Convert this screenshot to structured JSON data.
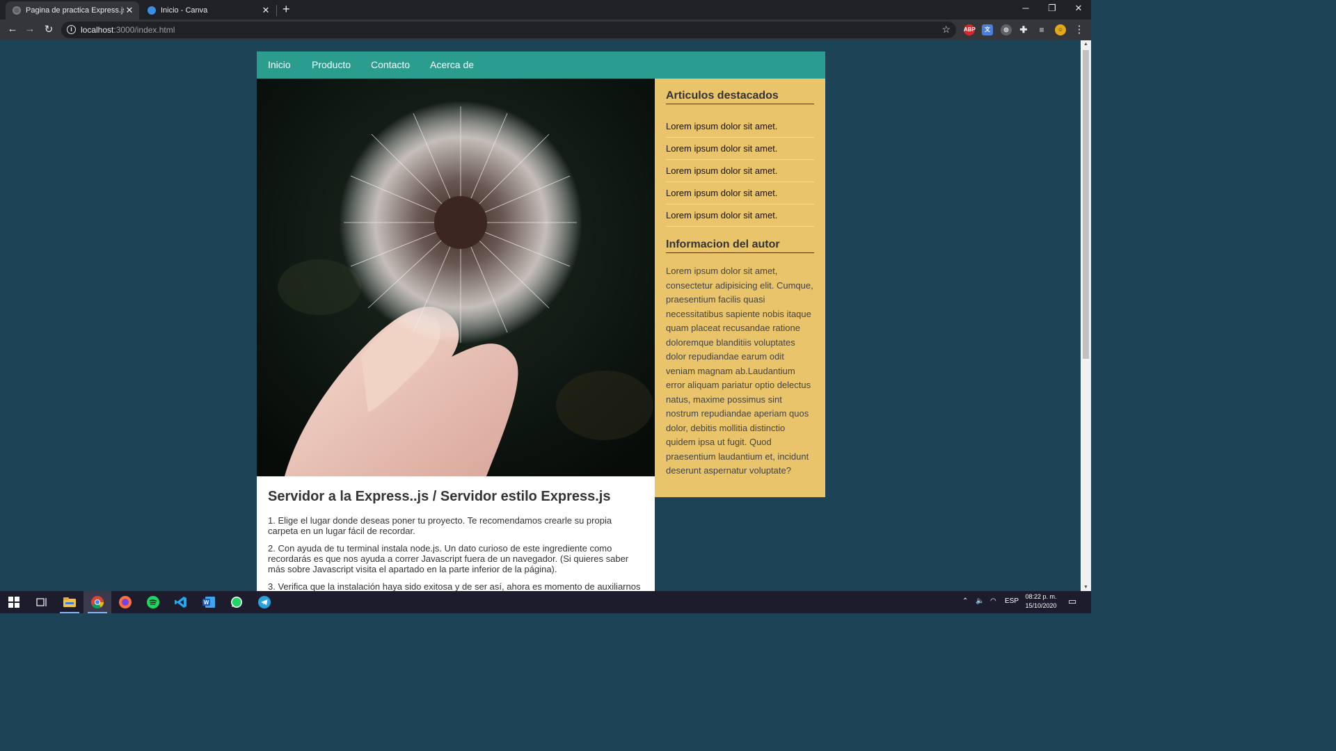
{
  "browser": {
    "tabs": [
      {
        "title": "Pagina de practica Express.js",
        "active": true
      },
      {
        "title": "Inicio - Canva",
        "active": false
      }
    ],
    "new_tab_label": "+",
    "url_host": "localhost",
    "url_path": ":3000/index.html",
    "extensions": [
      "adblock-plus-icon",
      "google-translate-icon",
      "privacy-icon",
      "extensions-puzzle-icon",
      "media-queue-icon",
      "profile-avatar"
    ],
    "ext_abp_label": "ABP"
  },
  "site": {
    "nav": [
      "Inicio",
      "Producto",
      "Contacto",
      "Acerca de"
    ],
    "article": {
      "title": "Servidor a la Express..js / Servidor estilo Express.js",
      "paragraphs": [
        "1. Elige el lugar donde deseas poner tu proyecto. Te recomendamos crearle su propia carpeta en un lugar fácil de recordar.",
        "2. Con ayuda de tu terminal instala node.js. Un dato curioso de este ingrediente como recordarás es que nos ayuda a correr Javascript fuera de un navegador. (Si quieres saber más sobre Javascript visita el apartado en la parte inferior de la página).",
        "3. Verifica que la instalación haya sido exitosa y de ser así, ahora es momento de auxiliarnos"
      ]
    },
    "sidebar": {
      "featured_title": "Articulos destacados",
      "featured_items": [
        "Lorem ipsum dolor sit amet.",
        "Lorem ipsum dolor sit amet.",
        "Lorem ipsum dolor sit amet.",
        "Lorem ipsum dolor sit amet.",
        "Lorem ipsum dolor sit amet."
      ],
      "author_title": "Informacion del autor",
      "author_bio": "Lorem ipsum dolor sit amet, consectetur adipisicing elit. Cumque, praesentium facilis quasi necessitatibus sapiente nobis itaque quam placeat recusandae ratione doloremque blanditiis voluptates dolor repudiandae earum odit veniam magnam ab.Laudantium error aliquam pariatur optio delectus natus, maxime possimus sint nostrum repudiandae aperiam quos dolor, debitis mollitia distinctio quidem ipsa ut fugit. Quod praesentium laudantium et, incidunt deserunt aspernatur voluptate?"
    },
    "colors": {
      "page_bg": "#1d4456",
      "nav_bg": "#2a9d8f",
      "sidebar_bg": "#e9c46a"
    }
  },
  "taskbar": {
    "apps": [
      "windows-start-icon",
      "task-view-icon",
      "file-explorer-icon",
      "chrome-icon",
      "firefox-icon",
      "spotify-icon",
      "vscode-icon",
      "word-icon",
      "whatsapp-icon",
      "telegram-icon"
    ],
    "language": "ESP",
    "time": "08:22 p. m.",
    "date": "15/10/2020"
  }
}
